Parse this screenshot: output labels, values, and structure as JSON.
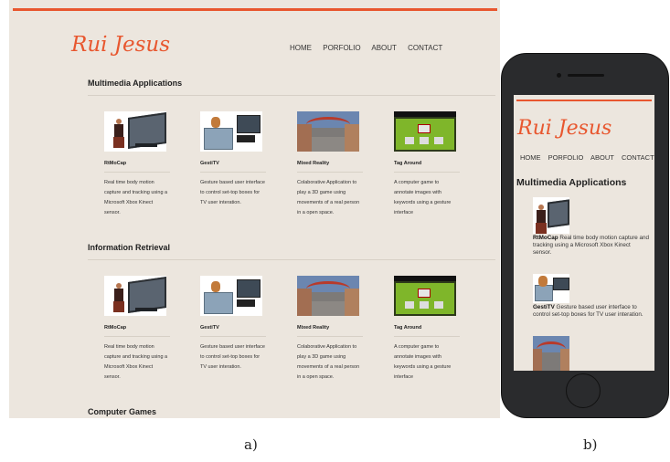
{
  "desktop": {
    "logo": "Rui Jesus",
    "nav": [
      "HOME",
      "PORFOLIO",
      "ABOUT",
      "CONTACT"
    ],
    "sections": [
      {
        "title": "Multimedia Applications",
        "items": [
          {
            "title": "RtMoCap",
            "desc": "Real time body motion capture and tracking using a Microsoft Xbox Kinect sensor."
          },
          {
            "title": "GestiTV",
            "desc": "Gesture based user interface to control set-top boxes for TV user interation."
          },
          {
            "title": "Mixed Reality",
            "desc": "Colaborative Application to play a 3D game using movements of a real person in a open space."
          },
          {
            "title": "Tag Around",
            "desc": "A computer game to annotate images with keywords using a gesture interface"
          }
        ]
      },
      {
        "title": "Information Retrieval",
        "items": [
          {
            "title": "RtMoCap",
            "desc": "Real time body motion capture and tracking using a Microsoft Xbox Kinect sensor."
          },
          {
            "title": "GestiTV",
            "desc": "Gesture based user interface to control set-top boxes for TV user interation."
          },
          {
            "title": "Mixed Reality",
            "desc": "Colaborative Application to play a 3D game using movements of a real person in a open space."
          },
          {
            "title": "Tag Around",
            "desc": "A computer game to annotate images with keywords using a gesture interface"
          }
        ]
      },
      {
        "title": "Computer Games"
      }
    ]
  },
  "mobile": {
    "logo": "Rui Jesus",
    "nav": [
      "HOME",
      "PORFOLIO",
      "ABOUT",
      "CONTACT"
    ],
    "section_title": "Multimedia Applications",
    "items": [
      {
        "title": "RtMoCap",
        "desc": "Real time body motion capture and tracking using a Microsoft Xbox Kinect sensor."
      },
      {
        "title": "GestiTV",
        "desc": "Gesture based user interface to control set-top boxes for TV user interation."
      }
    ]
  },
  "captions": {
    "a": "a)",
    "b": "b)"
  },
  "colors": {
    "accent": "#e8572f",
    "page_bg": "#ece6de"
  }
}
